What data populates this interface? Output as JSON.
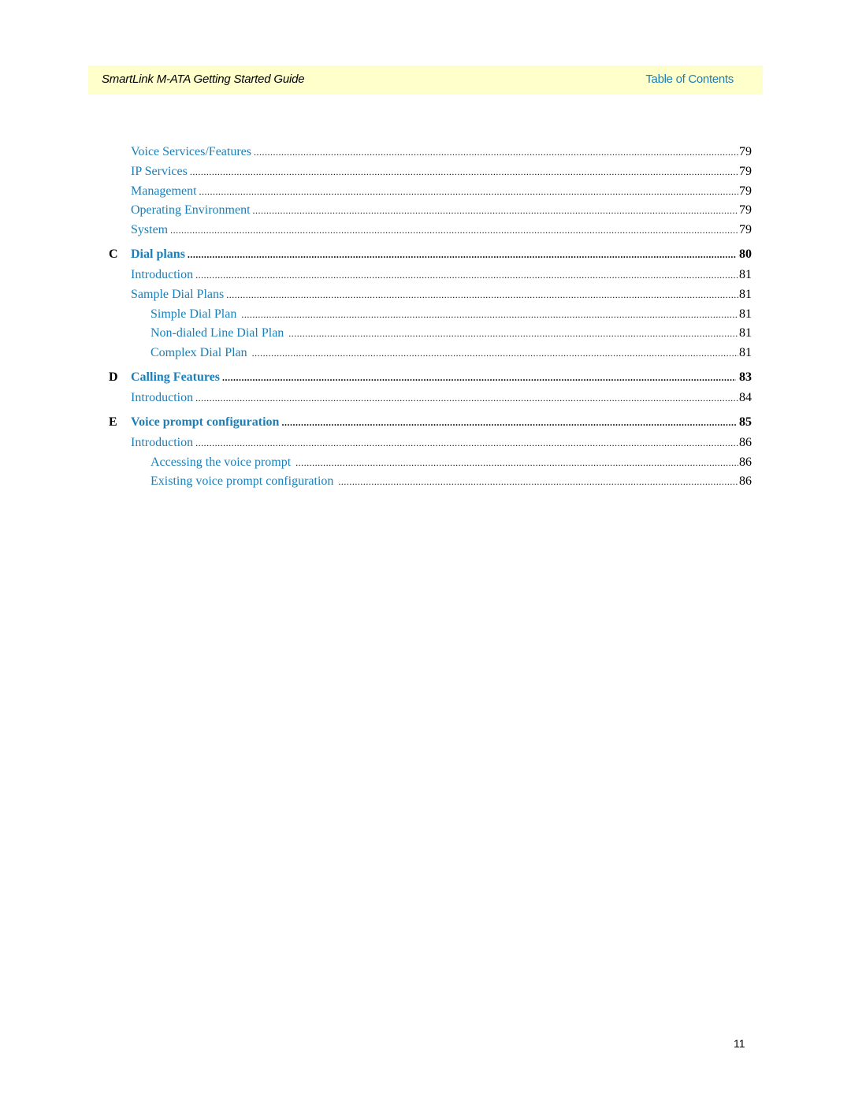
{
  "header": {
    "title": "SmartLink M-ATA Getting Started Guide",
    "link": "Table of Contents",
    "background": "#ffffcc",
    "accent": "#1a7fb8"
  },
  "toc": {
    "entries": [
      {
        "level": 2,
        "letter": "",
        "title": "Voice Services/Features",
        "page": "79"
      },
      {
        "level": 2,
        "letter": "",
        "title": "IP Services",
        "page": "79"
      },
      {
        "level": 2,
        "letter": "",
        "title": "Management",
        "page": "79"
      },
      {
        "level": 2,
        "letter": "",
        "title": "Operating Environment",
        "page": "79"
      },
      {
        "level": 2,
        "letter": "",
        "title": "System",
        "page": "79"
      },
      {
        "level": 1,
        "letter": "C",
        "title": "Dial plans",
        "page": "80"
      },
      {
        "level": 2,
        "letter": "",
        "title": "Introduction",
        "page": "81"
      },
      {
        "level": 2,
        "letter": "",
        "title": "Sample Dial Plans",
        "page": "81"
      },
      {
        "level": 3,
        "letter": "",
        "title": "Simple Dial Plan",
        "page": "81"
      },
      {
        "level": 3,
        "letter": "",
        "title": "Non-dialed Line Dial Plan",
        "page": "81"
      },
      {
        "level": 3,
        "letter": "",
        "title": "Complex Dial Plan",
        "page": "81"
      },
      {
        "level": 1,
        "letter": "D",
        "title": "Calling Features",
        "page": "83"
      },
      {
        "level": 2,
        "letter": "",
        "title": "Introduction",
        "page": "84"
      },
      {
        "level": 1,
        "letter": "E",
        "title": "Voice prompt configuration",
        "page": "85"
      },
      {
        "level": 2,
        "letter": "",
        "title": "Introduction",
        "page": "86"
      },
      {
        "level": 3,
        "letter": "",
        "title": "Accessing the voice prompt",
        "page": "86"
      },
      {
        "level": 3,
        "letter": "",
        "title": "Existing voice prompt configuration",
        "page": "86"
      }
    ]
  },
  "footer": {
    "page_number": "11"
  }
}
